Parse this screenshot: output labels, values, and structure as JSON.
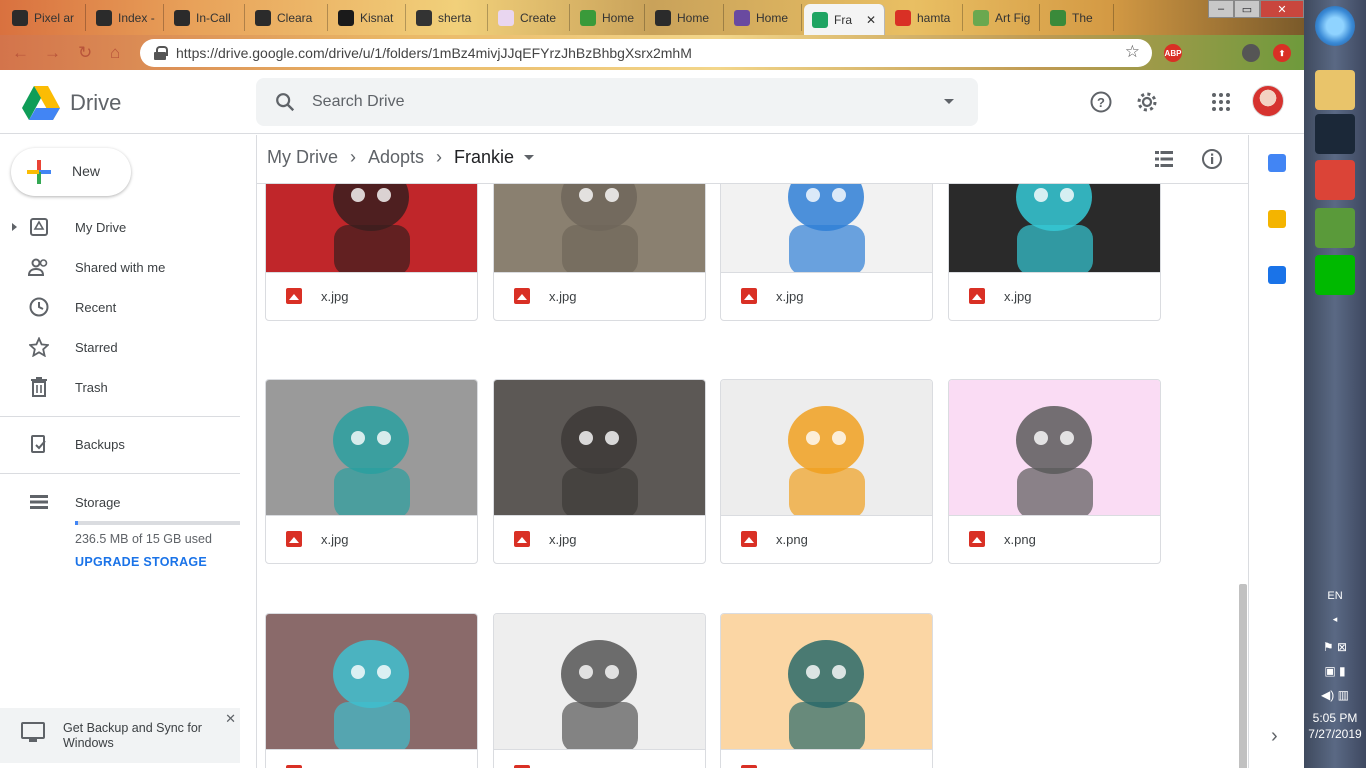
{
  "browser": {
    "tabs": [
      {
        "label": "Pixel ar",
        "color": "#2b2b2b"
      },
      {
        "label": "Index -",
        "color": "#2b2b2b"
      },
      {
        "label": "In-Call",
        "color": "#2b2b2b"
      },
      {
        "label": "Cleara",
        "color": "#2b2b2b"
      },
      {
        "label": "Kisnat",
        "color": "#1a1a1a"
      },
      {
        "label": "sherta",
        "color": "#333"
      },
      {
        "label": "Create",
        "color": "#e9d6f0"
      },
      {
        "label": "Home",
        "color": "#3a9a3a"
      },
      {
        "label": "Home",
        "color": "#2b2b2b"
      },
      {
        "label": "Home",
        "color": "#6a4aa0"
      },
      {
        "label": "Fra",
        "color": "#1fa463",
        "active": true
      },
      {
        "label": "hamta",
        "color": "#d93025"
      },
      {
        "label": "Art Fig",
        "color": "#6aa84f"
      },
      {
        "label": "The",
        "color": "#3a8a3a"
      }
    ],
    "tab_close": "✕",
    "url": "https://drive.google.com/drive/u/1/folders/1mBz4mivjJJqEFYrzJhBzBhbgXsrx2mhM",
    "bookmark_icon": "star-outline-icon",
    "extensions": [
      {
        "name": "abp-icon",
        "label": "ABP",
        "color": "#d93025"
      },
      {
        "name": "extension-avatar-icon",
        "label": "",
        "color": "#555"
      },
      {
        "name": "upload-extension-icon",
        "label": "⬆",
        "color": "#d93025"
      }
    ]
  },
  "drive": {
    "logo_text": "Drive",
    "search": {
      "placeholder": "Search Drive",
      "value": ""
    },
    "header_icons": [
      "help-icon",
      "settings-icon",
      "apps-grid-icon"
    ],
    "new_button": "New",
    "nav": [
      {
        "name": "my-drive",
        "label": "My Drive",
        "icon": "drive-icon",
        "expandable": true
      },
      {
        "name": "shared",
        "label": "Shared with me",
        "icon": "people-icon"
      },
      {
        "name": "recent",
        "label": "Recent",
        "icon": "clock-icon"
      },
      {
        "name": "starred",
        "label": "Starred",
        "icon": "star-icon"
      },
      {
        "name": "trash",
        "label": "Trash",
        "icon": "trash-icon"
      }
    ],
    "backups_label": "Backups",
    "storage": {
      "label": "Storage",
      "used_text": "236.5 MB of 15 GB used",
      "used_fraction": 0.0154,
      "upgrade": "UPGRADE STORAGE",
      "accent": "#1a73e8"
    },
    "backup_promo": {
      "text": "Get Backup and Sync for Windows",
      "close": "✕"
    },
    "breadcrumb": [
      "My Drive",
      "Adopts",
      "Frankie"
    ],
    "breadcrumb_sep": "›",
    "view_icons": [
      "list-view-icon",
      "info-icon"
    ],
    "files": [
      {
        "name": "x.jpg",
        "bg": "#c0262a",
        "fg": "#3a1e1e"
      },
      {
        "name": "x.jpg",
        "bg": "#8a8070",
        "fg": "#6f665a"
      },
      {
        "name": "x.jpg",
        "bg": "#f2f2f2",
        "fg": "#2f7fd6"
      },
      {
        "name": "x.jpg",
        "bg": "#2a2a2a",
        "fg": "#35c9d6"
      },
      {
        "name": "x.jpg",
        "bg": "#9a9a9a",
        "fg": "#2aa0a0"
      },
      {
        "name": "x.jpg",
        "bg": "#5c5855",
        "fg": "#3d3a38"
      },
      {
        "name": "x.png",
        "bg": "#ededed",
        "fg": "#f0a020"
      },
      {
        "name": "x.png",
        "bg": "#fadcf4",
        "fg": "#5a5a5a"
      },
      {
        "name": "",
        "bg": "#8a6a6a",
        "fg": "#3fbfcf"
      },
      {
        "name": "",
        "bg": "#eeeeee",
        "fg": "#555555"
      },
      {
        "name": "",
        "bg": "#fbd6a4",
        "fg": "#2a6a6a"
      }
    ],
    "right_panel_icons": [
      {
        "name": "calendar-icon",
        "color": "#4285f4"
      },
      {
        "name": "keep-icon",
        "color": "#f4b400"
      },
      {
        "name": "tasks-icon",
        "color": "#1a73e8"
      }
    ],
    "right_panel_expand": "›"
  },
  "taskbar": {
    "apps": [
      {
        "name": "start-orb-icon",
        "color": "#3a8ad6"
      },
      {
        "name": "file-explorer-icon",
        "color": "#e9c46a"
      },
      {
        "name": "steam-icon",
        "color": "#1b2838"
      },
      {
        "name": "chrome-icon",
        "color": "#db4437"
      },
      {
        "name": "game-icon",
        "color": "#5a9a3a"
      },
      {
        "name": "line-icon",
        "color": "#00b900"
      }
    ],
    "language": "EN",
    "time": "5:05 PM",
    "date": "7/27/2019"
  }
}
